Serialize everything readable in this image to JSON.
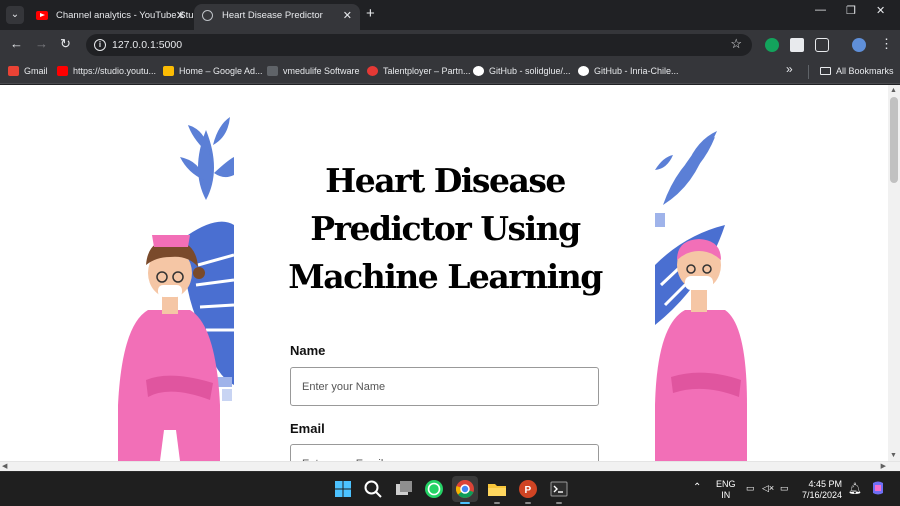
{
  "browser": {
    "tabs": [
      {
        "title": "Channel analytics - YouTube Studio",
        "active": false,
        "favicon": "youtube-icon"
      },
      {
        "title": "Heart Disease Predictor",
        "active": true,
        "favicon": "globe-icon"
      }
    ],
    "address": "127.0.0.1:5000",
    "bookmarks": [
      {
        "label": "Gmail",
        "icon": "gmail-icon",
        "color": "#ea4335"
      },
      {
        "label": "https://studio.youtu...",
        "icon": "youtube-icon",
        "color": "#ff0000"
      },
      {
        "label": "Home – Google Ad...",
        "icon": "google-ads-icon",
        "color": "#fbbc04"
      },
      {
        "label": "vmedulife Software",
        "icon": "vmedulife-icon",
        "color": "#9aa0a6"
      },
      {
        "label": "Talentployer – Partn...",
        "icon": "talentployer-icon",
        "color": "#e53935"
      },
      {
        "label": "GitHub - solidglue/...",
        "icon": "github-icon",
        "color": "#ffffff"
      },
      {
        "label": "GitHub - Inria-Chile...",
        "icon": "github-icon",
        "color": "#ffffff"
      }
    ],
    "bookmarks_more": "»",
    "all_bookmarks": "All Bookmarks"
  },
  "page": {
    "title": "Heart Disease Predictor Using Machine Learning",
    "fields": [
      {
        "label": "Name",
        "placeholder": "Enter your Name"
      },
      {
        "label": "Email",
        "placeholder": "Enter your Email"
      }
    ],
    "colors": {
      "accent_pink": "#f26fb7",
      "leaf_blue": "#5b7fd6",
      "text": "#000000"
    }
  },
  "taskbar": {
    "apps": [
      "start-icon",
      "search-icon",
      "task-view-icon",
      "whatsapp-icon",
      "chrome-icon",
      "file-explorer-icon",
      "powerpoint-icon",
      "terminal-icon"
    ],
    "language_top": "ENG",
    "language_bottom": "IN",
    "time": "4:45 PM",
    "date": "7/16/2024"
  }
}
